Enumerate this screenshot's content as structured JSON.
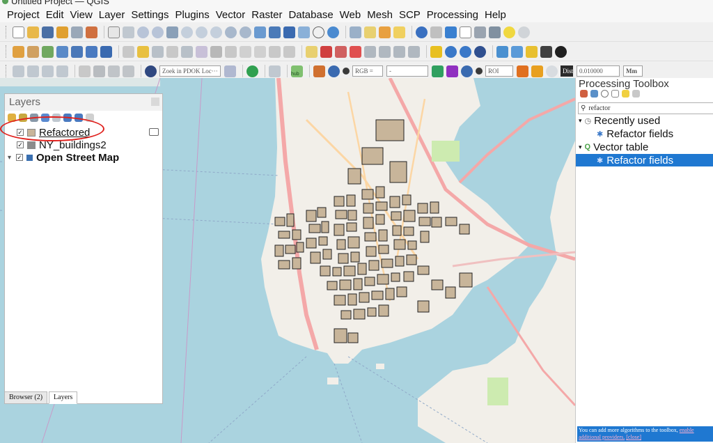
{
  "window": {
    "title": "Untitled Project — QGIS"
  },
  "menu": [
    "Project",
    "Edit",
    "View",
    "Layer",
    "Settings",
    "Plugins",
    "Vector",
    "Raster",
    "Database",
    "Web",
    "Mesh",
    "SCP",
    "Processing",
    "Help"
  ],
  "toolbar3": {
    "locator_placeholder": "Zoek in PDOK Loc···",
    "hub_label": "hub",
    "rgb_combo": "RGB =",
    "band_combo": "-",
    "roi_combo": "ROI",
    "dist_label": "Dist",
    "dist_value": "0.010000",
    "unit_combo": "Mm"
  },
  "layers_panel": {
    "title": "Layers",
    "items": [
      {
        "name": "Refactored",
        "checked": true,
        "color": "#c8b59a"
      },
      {
        "name": "NY_buildings2",
        "checked": true,
        "color": "#8c8c8c"
      },
      {
        "name": "Open Street Map",
        "checked": true,
        "color": "#3a6fb0"
      }
    ],
    "tabs": [
      "Browser (2)",
      "Layers"
    ]
  },
  "processing": {
    "title": "Processing Toolbox",
    "search": "refactor",
    "groups": [
      {
        "name": "Recently used",
        "items": [
          "Refactor fields"
        ]
      },
      {
        "name": "Vector table",
        "items": [
          "Refactor fields"
        ]
      }
    ],
    "message_text": "You can add more algorithms to the toolbox,",
    "message_link": "enable additional providers.",
    "message_close": "[close]"
  },
  "colors": {
    "selection": "#1f78d1",
    "highlight": "#e0201c",
    "water": "#aad3df",
    "land": "#f2efe9",
    "building": "#c8b59a"
  }
}
